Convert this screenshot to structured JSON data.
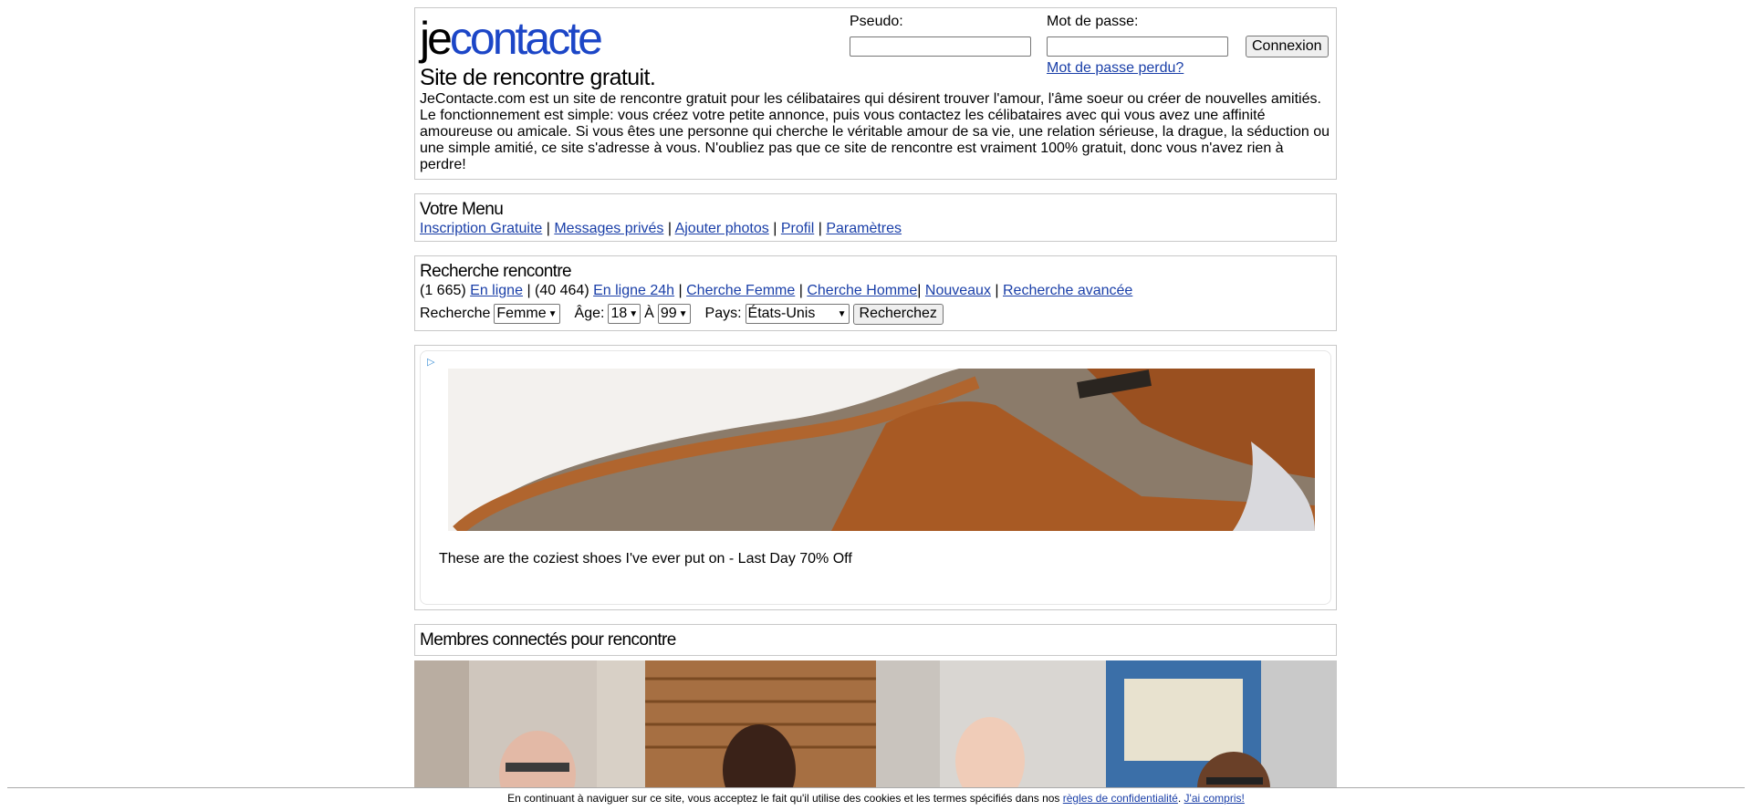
{
  "header": {
    "logo_part1": "je",
    "logo_part2": "contacte",
    "tagline": "Site de rencontre gratuit.",
    "intro": "JeContacte.com est un site de rencontre gratuit pour les célibataires qui désirent trouver l'amour, l'âme soeur ou créer de nouvelles amitiés. Le fonctionnement est simple: vous créez votre petite annonce, puis vous contactez les célibataires avec qui vous avez une affinité amoureuse ou amicale. Si vous êtes une personne qui cherche le véritable amour de sa vie, une relation sérieuse, la drague, la séduction ou une simple amitié, ce site s'adresse à vous. N'oubliez pas que ce site de rencontre est vraiment 100% gratuit, donc vous n'avez rien à perdre!"
  },
  "login": {
    "pseudo_label": "Pseudo:",
    "pseudo_value": "",
    "password_label": "Mot de passe:",
    "password_value": "",
    "submit_label": "Connexion",
    "lost_password": "Mot de passe perdu?"
  },
  "menu": {
    "title": "Votre Menu",
    "items": [
      "Inscription Gratuite",
      "Messages privés",
      "Ajouter photos",
      "Profil",
      "Paramètres"
    ],
    "separator": "|"
  },
  "search": {
    "title": "Recherche rencontre",
    "online_count": "(1 665)",
    "online_label": "En ligne",
    "online24_count": "(40 464)",
    "online24_label": "En ligne 24h",
    "links": [
      "Cherche Femme",
      "Cherche Homme",
      "Nouveaux",
      "Recherche avancée"
    ],
    "recherche_label": "Recherche",
    "gender_value": "Femme",
    "age_label": "Âge:",
    "age_min": "18",
    "age_to": "À",
    "age_max": "99",
    "country_label": "Pays:",
    "country_value": "États-Unis",
    "submit_label": "Recherchez"
  },
  "ad": {
    "choice_icon": "ad-choices-icon",
    "caption": "These are the coziest shoes I've ever put on - Last Day 70% Off"
  },
  "members": {
    "title": "Membres connectés pour rencontre",
    "count": 4
  },
  "cookie": {
    "text": "En continuant à naviguer sur ce site, vous acceptez le fait qu'il utilise des cookies et les termes spécifiés dans nos",
    "privacy_link": "règles de confidentialité",
    "period": ".",
    "accept_link": "J'ai compris!"
  },
  "colors": {
    "link": "#1a3fa8",
    "logo_accent": "#1c46c7",
    "border": "#c8c8c8"
  }
}
